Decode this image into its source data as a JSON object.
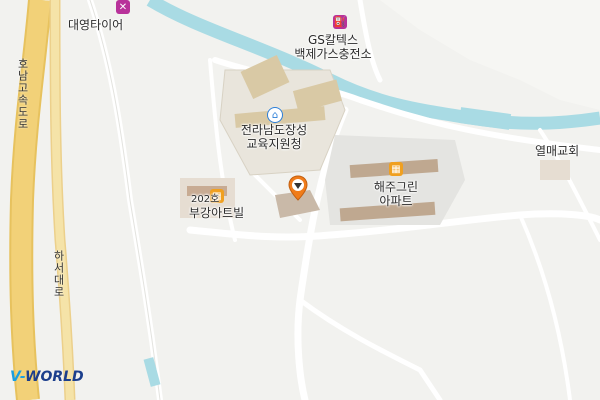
{
  "map": {
    "labels": {
      "tire_shop": "대영타이어",
      "gas_station_line1": "GS칼텍스",
      "gas_station_line2": "백제가스충전소",
      "office_line1": "전라남도장성",
      "office_line2": "교육지원청",
      "church": "열매교회",
      "apartment_line1": "해주그린",
      "apartment_line2": "아파트",
      "bugang_building": "202호",
      "bugang_name": "부강아트빌",
      "highway": "호남고속도로",
      "road": "하서대로"
    },
    "icons": {
      "tire_shop": "wrench-icon",
      "gas_station": "gas-station-icon",
      "office": "government-office-icon",
      "apartment": "apartment-icon",
      "bugang": "apartment-icon",
      "marker": "location-pin-icon"
    },
    "colors": {
      "background": "#f2f2ef",
      "highway": "#f2d178",
      "road": "#f5e3a8",
      "river": "#a9dbe4",
      "poi_magenta": "#b8329a",
      "poi_orange": "#f0a020",
      "poi_blue": "#2d7fd8",
      "marker": "#f07c1a"
    },
    "brand": {
      "logo_prefix": "V-",
      "logo_suffix": "WORLD"
    }
  }
}
